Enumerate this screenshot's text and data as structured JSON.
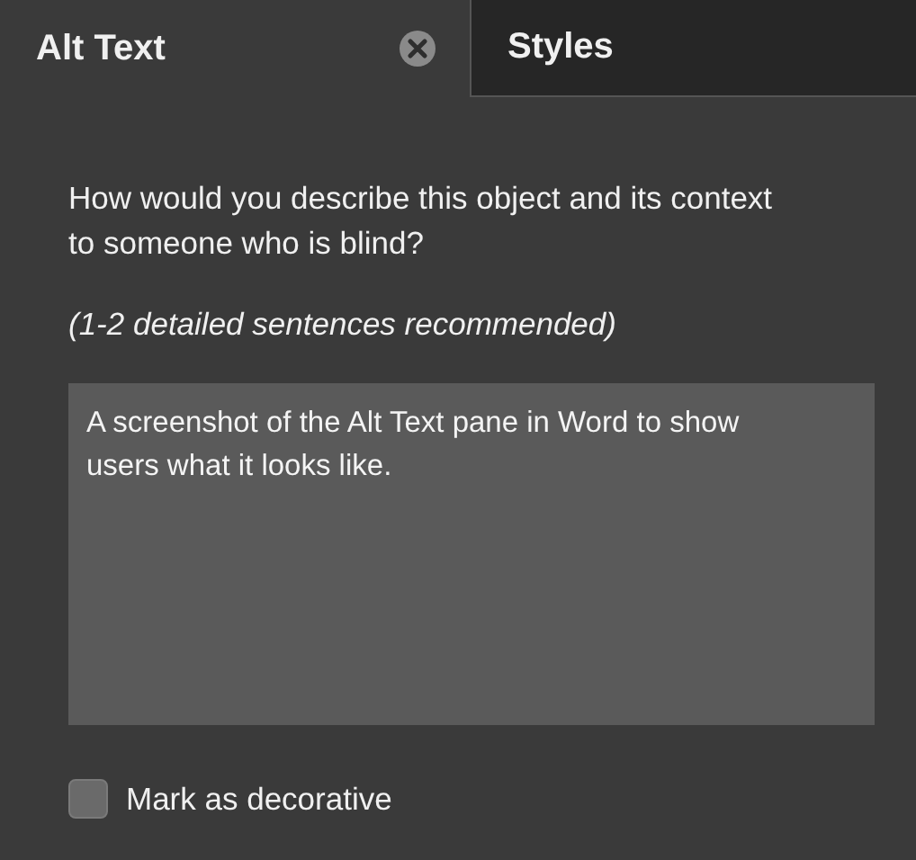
{
  "tabs": [
    {
      "label": "Alt Text",
      "selected": true,
      "closable": true
    },
    {
      "label": "Styles",
      "selected": false,
      "closable": false
    }
  ],
  "prompt": "How would you describe this object and its context to someone who is blind?",
  "hint": "(1-2 detailed sentences recommended)",
  "alt_text_field": {
    "value": "A screenshot of the Alt Text pane in Word to show users what it looks like."
  },
  "decorative_checkbox": {
    "label": "Mark as decorative",
    "checked": false
  }
}
